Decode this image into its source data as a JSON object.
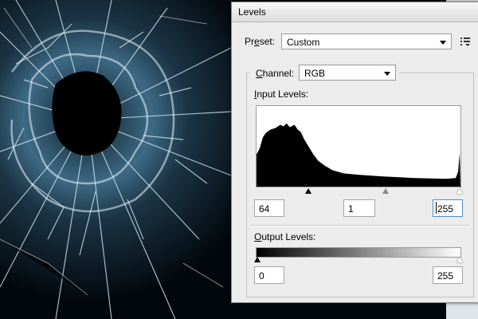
{
  "dialog": {
    "title": "Levels",
    "preset": {
      "label_pre": "Pr",
      "label_key": "e",
      "label_post": "set:",
      "value": "Custom"
    },
    "channel": {
      "label_key": "C",
      "label_post": "hannel:",
      "value": "RGB"
    },
    "input_levels": {
      "label_key": "I",
      "label_post": "nput Levels:",
      "black": "64",
      "gamma": "1",
      "white": "255"
    },
    "output_levels": {
      "label_key": "O",
      "label_post": "utput Levels:",
      "black": "0",
      "white": "255"
    }
  },
  "histogram_color": "#000000",
  "accent_colors": {
    "glass_highlight": "#cfe4f0",
    "glass_mid": "#5f8aa3",
    "background": "#000000"
  }
}
